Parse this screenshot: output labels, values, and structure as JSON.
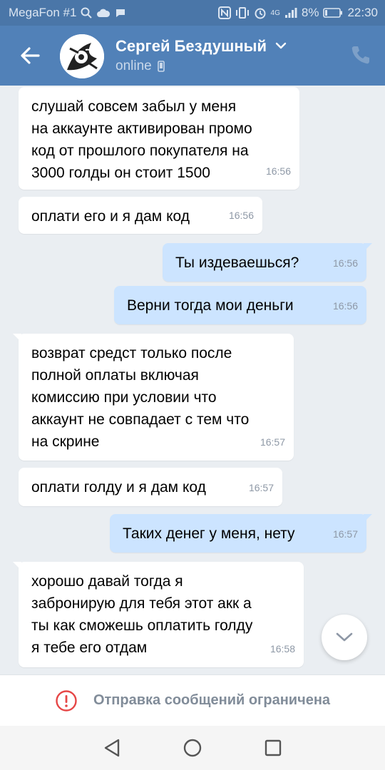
{
  "statusbar": {
    "carrier": "MegaFon #1",
    "battery": "8%",
    "time": "22:30",
    "network": "4G"
  },
  "header": {
    "contact_name": "Сергей Бездушный",
    "presence": "online"
  },
  "messages": [
    {
      "direction": "in",
      "text": "слушай совсем забыл у меня\nна аккаунте активирован промо\nкод от прошлого покупателя на\n3000 голды он стоит 1500",
      "time": "16:56"
    },
    {
      "direction": "in",
      "text": "оплати его и я дам код",
      "time": "16:56"
    },
    {
      "direction": "out",
      "text": "Ты издеваешься?",
      "time": "16:56"
    },
    {
      "direction": "out",
      "text": "Верни тогда мои деньги",
      "time": "16:56"
    },
    {
      "direction": "in",
      "text": "возврат средст только после\nполной оплаты включая\nкомиссию при условии что\nаккаунт не совпадает с тем что\nна скрине",
      "time": "16:57"
    },
    {
      "direction": "in",
      "text": "оплати голду и я дам код",
      "time": "16:57"
    },
    {
      "direction": "out",
      "text": "Таких денег у меня, нету",
      "time": "16:57"
    },
    {
      "direction": "in",
      "text": "хорошо давай тогда я\nзабронирую для тебя этот акк а\nты как сможешь оплатить голду\nя тебе его отдам",
      "time": "16:58"
    }
  ],
  "restriction": {
    "text": "Отправка сообщений ограничена"
  },
  "colors": {
    "status_bar": "#4a76a8",
    "header": "#5181b8",
    "chat_bg": "#eaeef2",
    "incoming_bubble": "#ffffff",
    "outgoing_bubble": "#cce4ff",
    "alert_red": "#e64646"
  }
}
